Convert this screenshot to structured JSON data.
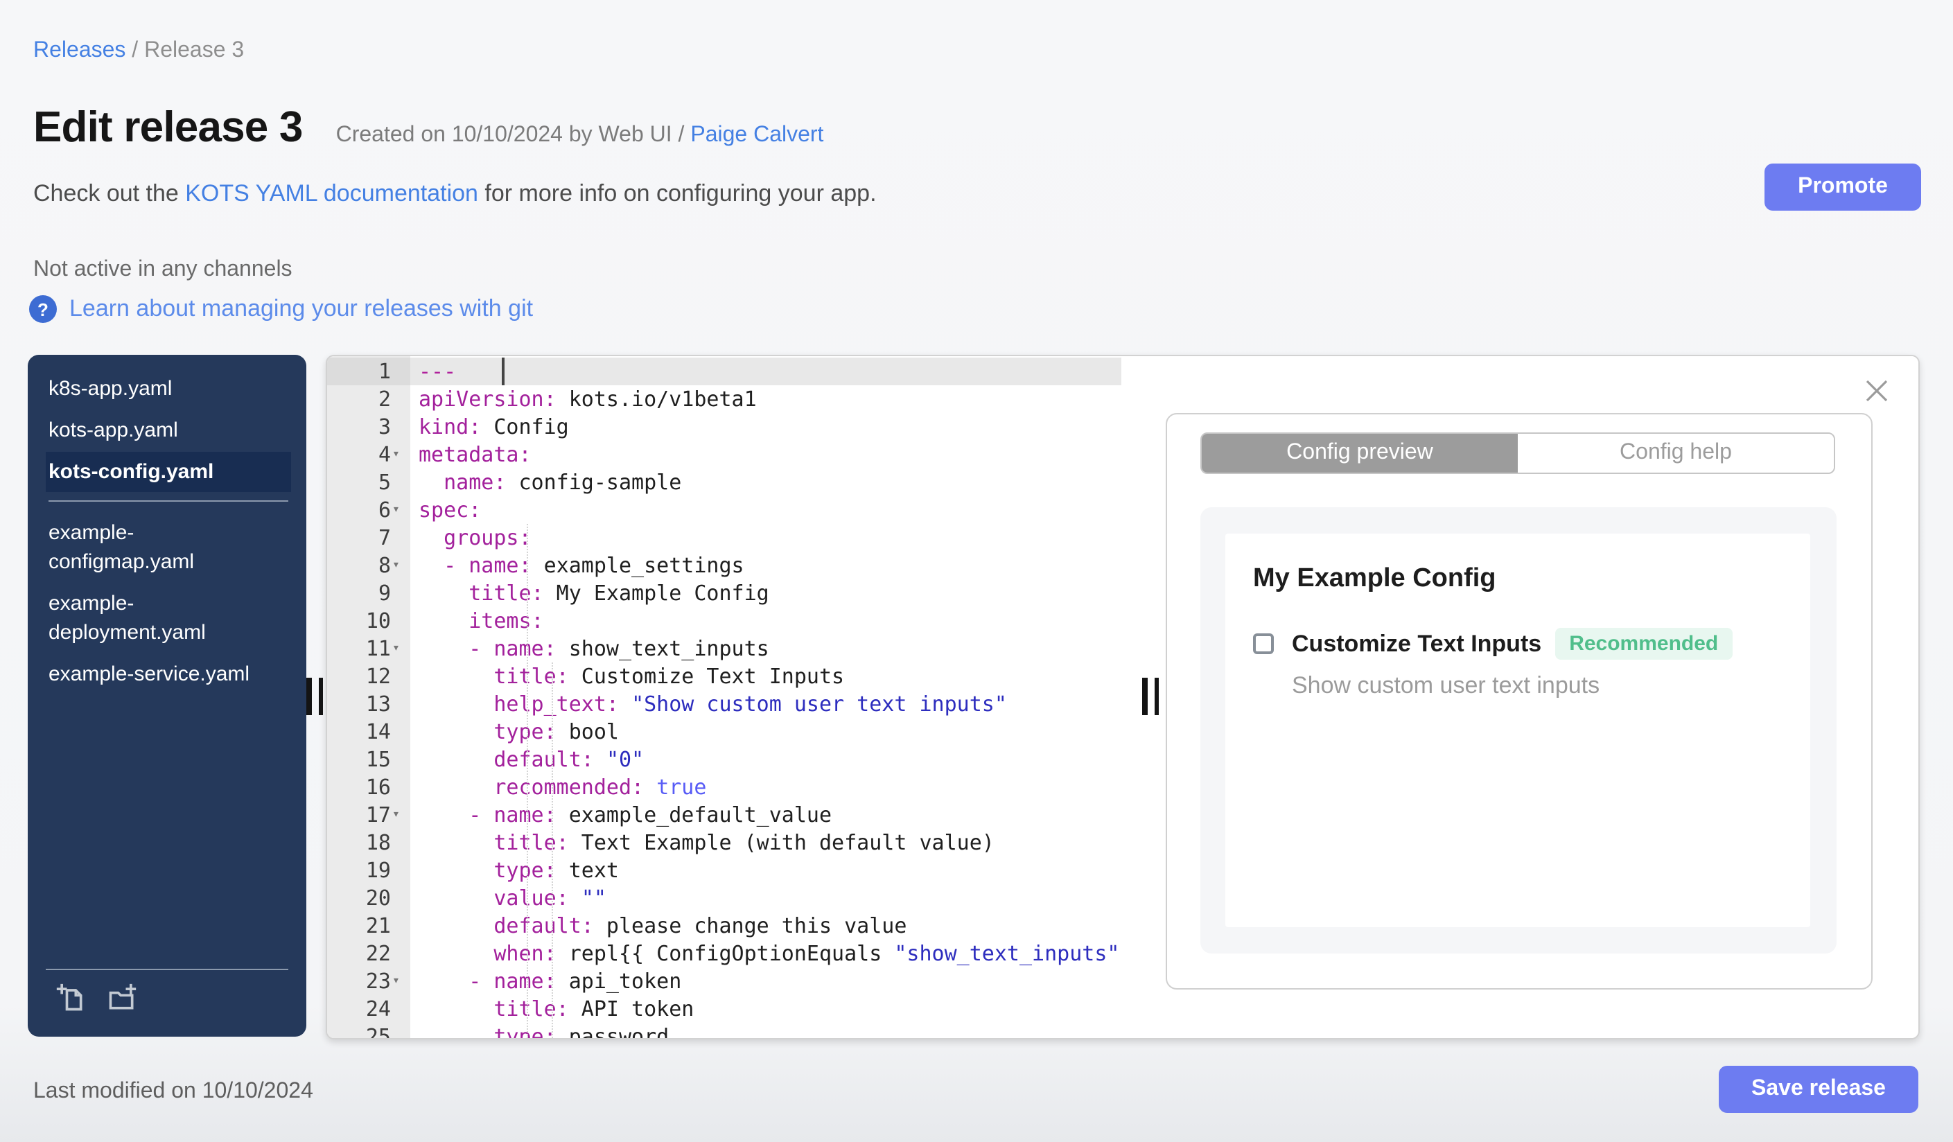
{
  "breadcrumb": {
    "link": "Releases",
    "separator": " / ",
    "current": "Release 3"
  },
  "header": {
    "title": "Edit release 3",
    "created_text": "Created on 10/10/2024 by Web UI / ",
    "created_author": "Paige Calvert",
    "docs_prefix": "Check out the ",
    "docs_link": "KOTS YAML documentation",
    "docs_suffix": " for more info on configuring your app.",
    "channel_status": "Not active in any channels",
    "help_icon": "?",
    "git_help_link": "Learn about managing your releases with git",
    "promote_label": "Promote"
  },
  "sidebar": {
    "file_groups": [
      [
        "k8s-app.yaml",
        "kots-app.yaml",
        "kots-config.yaml"
      ],
      [
        "example-configmap.yaml",
        "example-deployment.yaml",
        "example-service.yaml"
      ]
    ],
    "selected_file": "kots-config.yaml"
  },
  "editor": {
    "active_line": 1,
    "fold_lines": [
      4,
      6,
      8,
      11,
      17,
      23
    ],
    "lines": [
      [
        [
          "---",
          "sep"
        ]
      ],
      [
        [
          "apiVersion:",
          "key"
        ],
        [
          " kots.io/v1beta1",
          "plain"
        ]
      ],
      [
        [
          "kind:",
          "key"
        ],
        [
          " Config",
          "plain"
        ]
      ],
      [
        [
          "metadata:",
          "key"
        ]
      ],
      [
        [
          "  ",
          "plain"
        ],
        [
          "name:",
          "key"
        ],
        [
          " config-sample",
          "plain"
        ]
      ],
      [
        [
          "spec:",
          "key"
        ]
      ],
      [
        [
          "  ",
          "plain"
        ],
        [
          "groups:",
          "key"
        ]
      ],
      [
        [
          "  ",
          "plain"
        ],
        [
          "- name:",
          "key"
        ],
        [
          " example_settings",
          "plain"
        ]
      ],
      [
        [
          "    ",
          "plain"
        ],
        [
          "title:",
          "key"
        ],
        [
          " My Example Config",
          "plain"
        ]
      ],
      [
        [
          "    ",
          "plain"
        ],
        [
          "items:",
          "key"
        ]
      ],
      [
        [
          "    ",
          "plain"
        ],
        [
          "- name:",
          "key"
        ],
        [
          " show_text_inputs",
          "plain"
        ]
      ],
      [
        [
          "      ",
          "plain"
        ],
        [
          "title:",
          "key"
        ],
        [
          " Customize Text Inputs",
          "plain"
        ]
      ],
      [
        [
          "      ",
          "plain"
        ],
        [
          "help_text:",
          "key"
        ],
        [
          " ",
          "plain"
        ],
        [
          "\"Show custom user text inputs\"",
          "str"
        ]
      ],
      [
        [
          "      ",
          "plain"
        ],
        [
          "type:",
          "key"
        ],
        [
          " bool",
          "plain"
        ]
      ],
      [
        [
          "      ",
          "plain"
        ],
        [
          "default:",
          "key"
        ],
        [
          " ",
          "plain"
        ],
        [
          "\"0\"",
          "str"
        ]
      ],
      [
        [
          "      ",
          "plain"
        ],
        [
          "recommended:",
          "key"
        ],
        [
          " ",
          "plain"
        ],
        [
          "true",
          "bool"
        ]
      ],
      [
        [
          "    ",
          "plain"
        ],
        [
          "- name:",
          "key"
        ],
        [
          " example_default_value",
          "plain"
        ]
      ],
      [
        [
          "      ",
          "plain"
        ],
        [
          "title:",
          "key"
        ],
        [
          " Text Example (with default value)",
          "plain"
        ]
      ],
      [
        [
          "      ",
          "plain"
        ],
        [
          "type:",
          "key"
        ],
        [
          " text",
          "plain"
        ]
      ],
      [
        [
          "      ",
          "plain"
        ],
        [
          "value:",
          "key"
        ],
        [
          " ",
          "plain"
        ],
        [
          "\"\"",
          "str"
        ]
      ],
      [
        [
          "      ",
          "plain"
        ],
        [
          "default:",
          "key"
        ],
        [
          " please change this value",
          "plain"
        ]
      ],
      [
        [
          "      ",
          "plain"
        ],
        [
          "when:",
          "key"
        ],
        [
          " repl{{ ConfigOptionEquals ",
          "plain"
        ],
        [
          "\"show_text_inputs\"",
          "str"
        ]
      ],
      [
        [
          "    ",
          "plain"
        ],
        [
          "- name:",
          "key"
        ],
        [
          " api_token",
          "plain"
        ]
      ],
      [
        [
          "      ",
          "plain"
        ],
        [
          "title:",
          "key"
        ],
        [
          " API token",
          "plain"
        ]
      ],
      [
        [
          "      ",
          "plain"
        ],
        [
          "type:",
          "key"
        ],
        [
          " password",
          "plain"
        ]
      ]
    ]
  },
  "preview": {
    "tabs": [
      {
        "label": "Config preview",
        "active": true
      },
      {
        "label": "Config help",
        "active": false
      }
    ],
    "group_title": "My Example Config",
    "item": {
      "label": "Customize Text Inputs",
      "badge": "Recommended",
      "help_text": "Show custom user text inputs",
      "checked": false
    }
  },
  "footer": {
    "last_modified": "Last modified on 10/10/2024",
    "save_label": "Save release"
  },
  "colors": {
    "link-blue": "#4480e3",
    "button-purple": "#6d7cf1",
    "sidebar-bg": "#25395b",
    "sidebar-selected": "#182d52",
    "code-key": "#a3219c",
    "code-str": "#2d2dbe",
    "code-bool": "#585cf6",
    "tab-gray": "#9c9c9c",
    "badge-green": "#50be8b",
    "badge-bg": "#e8f7f0"
  }
}
